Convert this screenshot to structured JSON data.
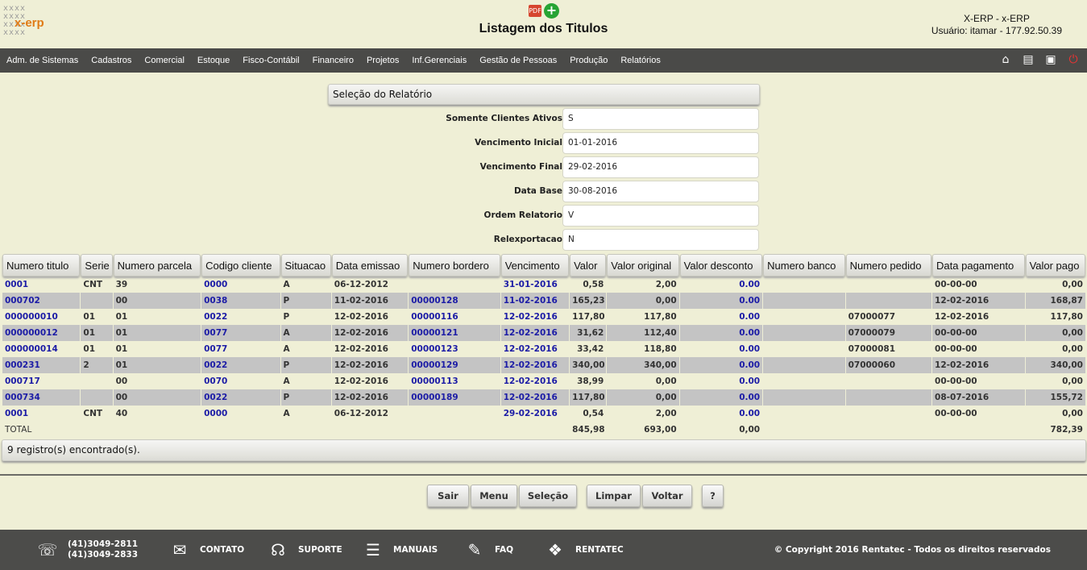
{
  "header": {
    "logo_text": "x-erp",
    "title": "Listagem dos Titulos",
    "system": "X-ERP - x-ERP",
    "user": "Usuário: itamar - 177.92.50.39",
    "icons": [
      "pdf-icon",
      "add-icon"
    ]
  },
  "nav": {
    "items": [
      "Adm. de Sistemas",
      "Cadastros",
      "Comercial",
      "Estoque",
      "Fisco-Contábil",
      "Financeiro",
      "Projetos",
      "Inf.Gerenciais",
      "Gestão de Pessoas",
      "Produção",
      "Relatórios"
    ],
    "right_icons": [
      "home-icon",
      "document-icon",
      "print-icon",
      "power-icon"
    ]
  },
  "selection": {
    "title": "Seleção do Relatório",
    "fields": [
      {
        "label": "Somente Clientes Ativos",
        "value": "S"
      },
      {
        "label": "Vencimento Inicial",
        "value": "01-01-2016"
      },
      {
        "label": "Vencimento Final",
        "value": "29-02-2016"
      },
      {
        "label": "Data Base",
        "value": "30-08-2016"
      },
      {
        "label": "Ordem Relatorio",
        "value": "V"
      },
      {
        "label": "Relexportacao",
        "value": "N"
      }
    ]
  },
  "table": {
    "columns": [
      "Numero titulo",
      "Serie",
      "Numero parcela",
      "Codigo cliente",
      "Situacao",
      "Data emissao",
      "Numero bordero",
      "Vencimento",
      "Valor",
      "Valor original",
      "Valor desconto",
      "Numero banco",
      "Numero pedido",
      "Data pagamento",
      "Valor pago"
    ],
    "rows": [
      [
        "0001",
        "CNT",
        "39",
        "0000",
        "A",
        "06-12-2012",
        "",
        "31-01-2016",
        "0,58",
        "2,00",
        "0.00",
        "",
        "",
        "00-00-00",
        "0,00"
      ],
      [
        "000702",
        "",
        "00",
        "0038",
        "P",
        "11-02-2016",
        "00000128",
        "11-02-2016",
        "165,23",
        "0,00",
        "0.00",
        "",
        "",
        "12-02-2016",
        "168,87"
      ],
      [
        "000000010",
        "01",
        "01",
        "0022",
        "P",
        "12-02-2016",
        "00000116",
        "12-02-2016",
        "117,80",
        "117,80",
        "0.00",
        "",
        "07000077",
        "12-02-2016",
        "117,80"
      ],
      [
        "000000012",
        "01",
        "01",
        "0077",
        "A",
        "12-02-2016",
        "00000121",
        "12-02-2016",
        "31,62",
        "112,40",
        "0.00",
        "",
        "07000079",
        "00-00-00",
        "0,00"
      ],
      [
        "000000014",
        "01",
        "01",
        "0077",
        "A",
        "12-02-2016",
        "00000123",
        "12-02-2016",
        "33,42",
        "118,80",
        "0.00",
        "",
        "07000081",
        "00-00-00",
        "0,00"
      ],
      [
        "000231",
        "2",
        "01",
        "0022",
        "P",
        "12-02-2016",
        "00000129",
        "12-02-2016",
        "340,00",
        "340,00",
        "0.00",
        "",
        "07000060",
        "12-02-2016",
        "340,00"
      ],
      [
        "000717",
        "",
        "00",
        "0070",
        "A",
        "12-02-2016",
        "00000113",
        "12-02-2016",
        "38,99",
        "0,00",
        "0.00",
        "",
        "",
        "00-00-00",
        "0,00"
      ],
      [
        "000734",
        "",
        "00",
        "0022",
        "P",
        "12-02-2016",
        "00000189",
        "12-02-2016",
        "117,80",
        "0,00",
        "0.00",
        "",
        "",
        "08-07-2016",
        "155,72"
      ],
      [
        "0001",
        "CNT",
        "40",
        "0000",
        "A",
        "06-12-2012",
        "",
        "29-02-2016",
        "0,54",
        "2,00",
        "0.00",
        "",
        "",
        "00-00-00",
        "0,00"
      ]
    ],
    "total": {
      "label": "TOTAL",
      "valor": "845,98",
      "valor_original": "693,00",
      "valor_desconto": "0,00",
      "valor_pago": "782,39"
    }
  },
  "result_count": "9 registro(s) encontrado(s).",
  "buttons": {
    "sair": "Sair",
    "menu": "Menu",
    "selecao": "Seleção",
    "limpar": "Limpar",
    "voltar": "Voltar",
    "help": "?"
  },
  "footer": {
    "phone1": "(41)3049-2811",
    "phone2": "(41)3049-2833",
    "contato": "CONTATO",
    "suporte": "SUPORTE",
    "manuais": "MANUAIS",
    "faq": "FAQ",
    "rentatec": "RENTATEC",
    "copyright": "© Copyright 2016 Rentatec - Todos os direitos reservados"
  },
  "colors": {
    "background": "#efefd6",
    "nav": "#4a4a48",
    "link": "#1c1ca6",
    "alt_row": "#c4c4c4"
  }
}
